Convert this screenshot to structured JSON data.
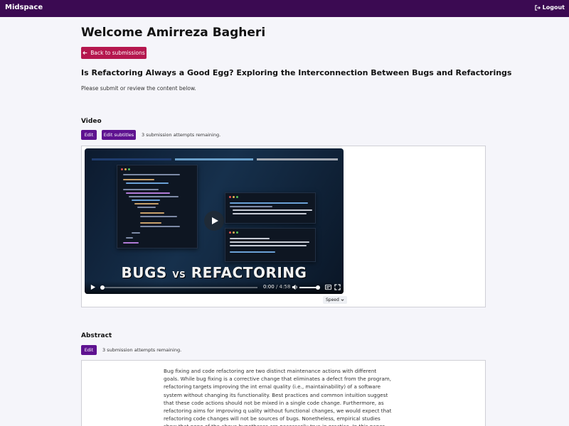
{
  "topbar": {
    "brand": "Midspace",
    "logout_label": "Logout"
  },
  "welcome": "Welcome Amirreza Bagheri",
  "back_button": "Back to submissions",
  "paper_title": "Is Refactoring Always a Good Egg? Exploring the Interconnection Between Bugs and Refactorings",
  "instructions": "Please submit or review the content below.",
  "video": {
    "heading": "Video",
    "edit_label": "Edit",
    "edit_subtitles_label": "Edit subtitles",
    "attempts": "3 submission attempts remaining.",
    "overlay_title_left": "BUGS",
    "overlay_title_vs": "VS",
    "overlay_title_right": "REFACTORING",
    "current_time": "0:00",
    "duration": "/ 4:58",
    "speed_label": "Speed",
    "played_fraction": 0,
    "volume_fraction": 1
  },
  "abstract": {
    "heading": "Abstract",
    "edit_label": "Edit",
    "attempts": "3 submission attempts remaining.",
    "text": "Bug fixing and code refactoring are two distinct maintenance actions with different goals. While bug fixing is a corrective change that eliminates a defect from the program, refactoring targets improving the int ernal quality (i.e., maintainability) of a software system without changing its functionality. Best practices and common intuition suggest that these code actions should not be mixed in a single code change. Furthermore, as refactoring aims for improving q uality without functional changes, we would expect that refactoring code changes will not be sources of bugs. Nonetheless, empirical studies show that none of the above hypotheses are necessarily true in practice. In this paper, we empirically investigate the interconnection between bug related and refactoring code changes using the"
  },
  "colors": {
    "topbar": "#3b0a52",
    "back_button": "#b5174e",
    "action_button": "#5e1290",
    "background": "#f5f5fa"
  },
  "icons": [
    "logout-icon",
    "arrow-left-icon",
    "play-icon",
    "volume-icon",
    "captions-icon",
    "fullscreen-icon",
    "chevron-down-icon"
  ]
}
